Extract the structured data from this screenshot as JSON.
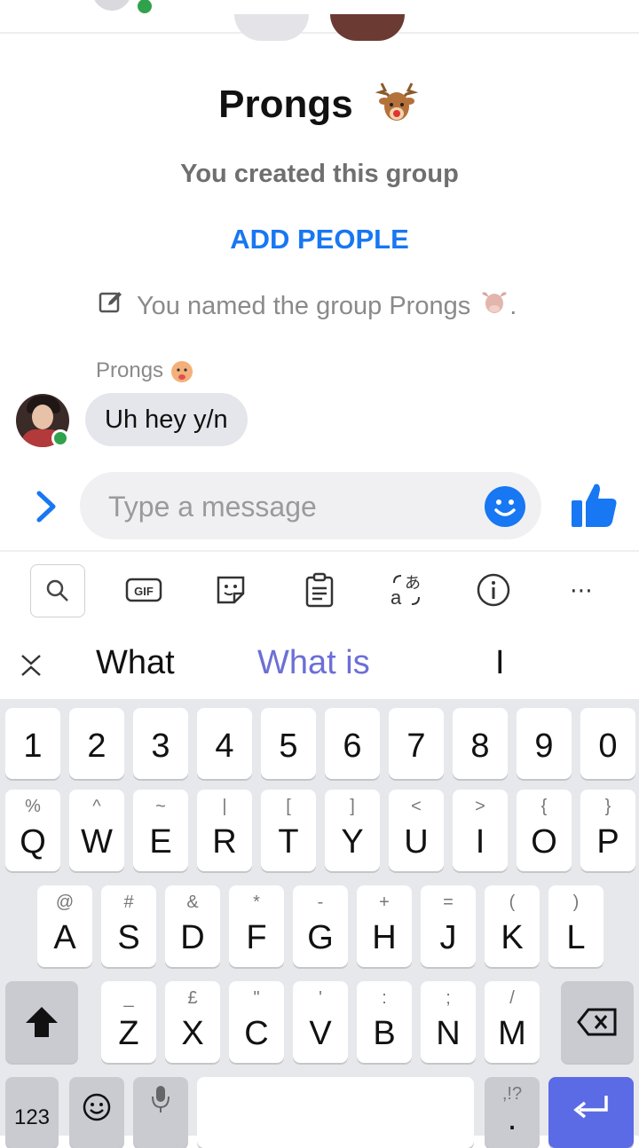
{
  "header": {
    "group_name": "Prongs",
    "created_text": "You created this group",
    "add_people_label": "ADD PEOPLE",
    "named_text": "You named the group Prongs",
    "named_suffix": "."
  },
  "messages": [
    {
      "sender": "Prongs",
      "text": "Uh hey y/n"
    }
  ],
  "composer": {
    "placeholder": "Type a message"
  },
  "suggestions": [
    "What",
    "What is",
    "I"
  ],
  "keyboard": {
    "number_row": [
      "1",
      "2",
      "3",
      "4",
      "5",
      "6",
      "7",
      "8",
      "9",
      "0"
    ],
    "row1": [
      {
        "main": "Q",
        "sub": "%"
      },
      {
        "main": "W",
        "sub": "^"
      },
      {
        "main": "E",
        "sub": "~"
      },
      {
        "main": "R",
        "sub": "|"
      },
      {
        "main": "T",
        "sub": "["
      },
      {
        "main": "Y",
        "sub": "]"
      },
      {
        "main": "U",
        "sub": "<"
      },
      {
        "main": "I",
        "sub": ">"
      },
      {
        "main": "O",
        "sub": "{"
      },
      {
        "main": "P",
        "sub": "}"
      }
    ],
    "row2": [
      {
        "main": "A",
        "sub": "@"
      },
      {
        "main": "S",
        "sub": "#"
      },
      {
        "main": "D",
        "sub": "&"
      },
      {
        "main": "F",
        "sub": "*"
      },
      {
        "main": "G",
        "sub": "-"
      },
      {
        "main": "H",
        "sub": "+"
      },
      {
        "main": "J",
        "sub": "="
      },
      {
        "main": "K",
        "sub": "("
      },
      {
        "main": "L",
        "sub": ")"
      }
    ],
    "row3": [
      {
        "main": "Z",
        "sub": "_"
      },
      {
        "main": "X",
        "sub": "£"
      },
      {
        "main": "C",
        "sub": "\""
      },
      {
        "main": "V",
        "sub": "'"
      },
      {
        "main": "B",
        "sub": ":"
      },
      {
        "main": "N",
        "sub": ";"
      },
      {
        "main": "M",
        "sub": "/"
      }
    ],
    "bottom": {
      "symbols_label": "123",
      "punct_sub": ",!?",
      "punct_main": "."
    }
  },
  "colors": {
    "accent": "#1877f2",
    "online": "#31a24c",
    "suggestion_highlight": "#6c6fd6",
    "enter_key": "#5b6ae5"
  }
}
